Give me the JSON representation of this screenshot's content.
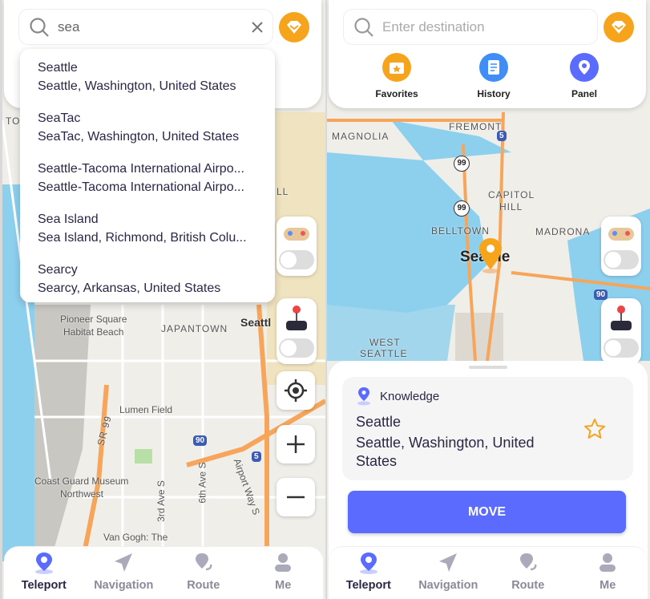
{
  "left": {
    "search": {
      "value": "sea"
    },
    "results": [
      {
        "name": "Seattle",
        "detail": "Seattle, Washington, United States"
      },
      {
        "name": "SeaTac",
        "detail": "SeaTac, Washington, United States"
      },
      {
        "name": "Seattle-Tacoma International Airpo...",
        "detail": "Seattle-Tacoma International Airpo..."
      },
      {
        "name": "Sea Island",
        "detail": "Sea Island, Richmond, British Colu..."
      },
      {
        "name": "Searcy",
        "detail": "Searcy, Arkansas, United States"
      }
    ],
    "map_labels": {
      "pioneer": "Pioneer Square",
      "habitat": "Habitat Beach",
      "japantown": "JAPANTOWN",
      "seattle": "Seattl",
      "lumen": "Lumen Field",
      "sr99": "SR 99",
      "coast1": "Coast Guard Museum",
      "coast2": "Northwest",
      "ave3": "3rd Ave S",
      "ave6": "6th Ave S",
      "airport": "Airport Way S",
      "vangogh": "Van Gogh: The",
      "i90": "90",
      "i5": "5",
      "to": "TO",
      "ll": "LL"
    }
  },
  "right": {
    "search": {
      "placeholder": "Enter destination"
    },
    "quick": [
      {
        "label": "Favorites",
        "color": "#f7a41d"
      },
      {
        "label": "History",
        "color": "#3f8ef7"
      },
      {
        "label": "Panel",
        "color": "#5a6bfd"
      }
    ],
    "map_labels": {
      "fremont": "FREMONT",
      "magnolia": "MAGNOLIA",
      "capitol1": "CAPITOL",
      "capitol2": "HILL",
      "belltown": "BELLTOWN",
      "madrona": "MADRONA",
      "seattle": "Seattle",
      "west1": "WEST",
      "west2": "SEATTLE",
      "h99a": "99",
      "h99b": "99",
      "i5": "5",
      "i90": "90"
    },
    "info": {
      "source": "Knowledge",
      "name": "Seattle",
      "detail": "Seattle, Washington, United States"
    },
    "move_label": "MOVE"
  },
  "tabs": [
    {
      "label": "Teleport",
      "active": true
    },
    {
      "label": "Navigation"
    },
    {
      "label": "Route"
    },
    {
      "label": "Me"
    }
  ],
  "colors": {
    "accent": "#5a6bfd",
    "vip": "#f7a41d",
    "water": "#8dd0ee",
    "highway": "#f6a55a"
  }
}
